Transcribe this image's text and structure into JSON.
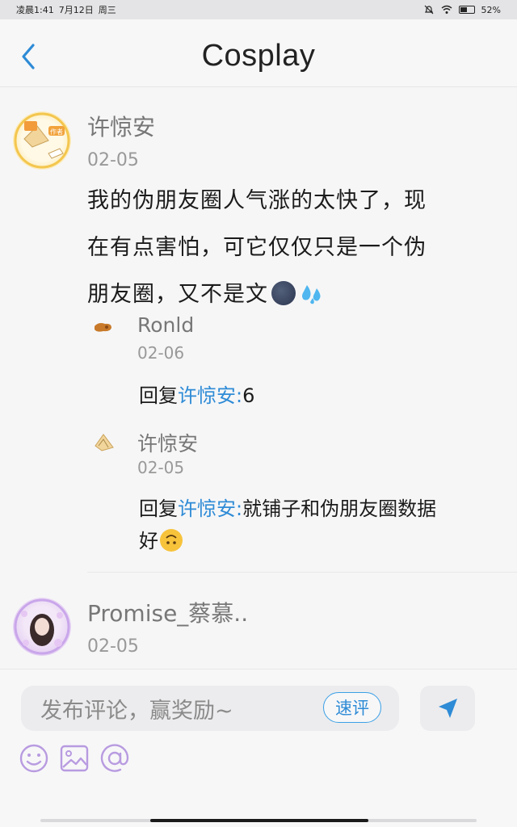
{
  "status_bar": {
    "time": "凌晨1:41",
    "date": "7月12日",
    "weekday": "周三",
    "battery": "52%",
    "battery_level": 0.52
  },
  "header": {
    "title": "Cosplay",
    "back_icon": "chevron-left-icon"
  },
  "comments": [
    {
      "author": "许惊安",
      "date": "02-05",
      "text_lines": [
        "我的伪朋友圈人气涨的太快了，现",
        "在有点害怕，可它仅仅只是一个伪",
        "朋友圈，又不是文"
      ],
      "emojis": [
        "new-moon-face-icon",
        "sweat-droplets-icon"
      ],
      "replies": [
        {
          "author": "Ronld",
          "date": "02-06",
          "prefix": "回复",
          "target": "许惊安:",
          "text": "6"
        },
        {
          "author": "许惊安",
          "date": "02-05",
          "prefix": "回复",
          "target": "许惊安:",
          "text": "就铺子和伪朋友圈数据",
          "text_line2": "好",
          "emoji": "upside-down-face-icon"
        }
      ]
    },
    {
      "author": "Promise_蔡慕..",
      "date": "02-05"
    }
  ],
  "input": {
    "placeholder": "发布评论，赢奖励~",
    "quick_comment": "速评",
    "send_icon": "send-icon"
  },
  "tools": [
    "emoji-icon",
    "image-icon",
    "mention-icon"
  ],
  "colors": {
    "link": "#2e8bd6",
    "accent": "#3ba0e6",
    "tool_icon": "#b89be0"
  }
}
